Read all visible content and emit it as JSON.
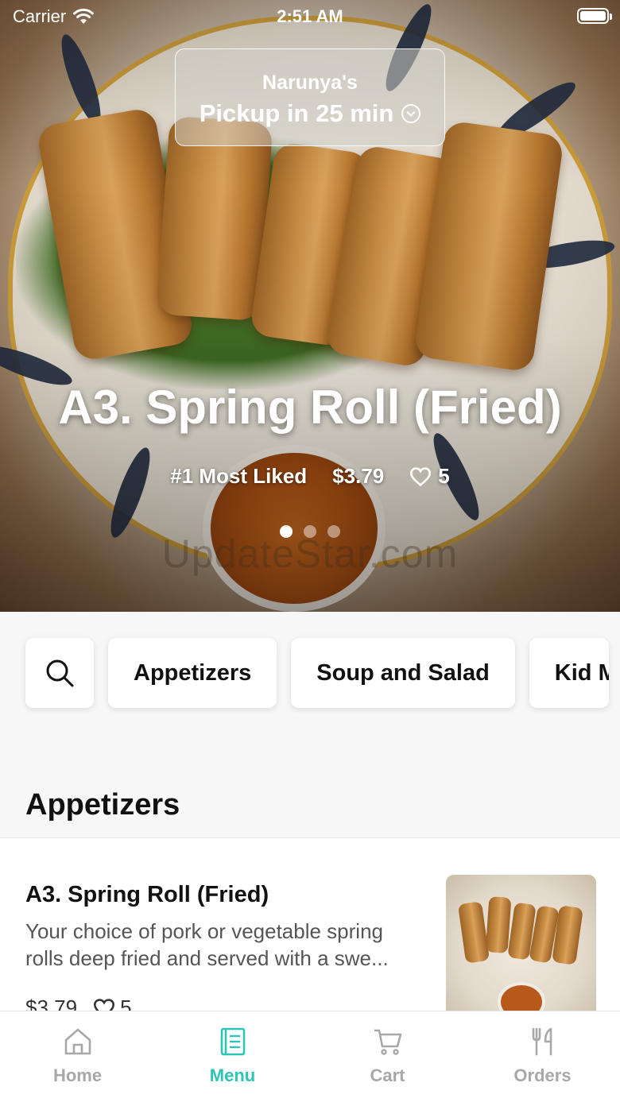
{
  "status_bar": {
    "carrier": "Carrier",
    "time": "2:51 AM"
  },
  "pickup": {
    "restaurant": "Narunya's",
    "eta": "Pickup in 25 min"
  },
  "hero": {
    "title": "A3. Spring Roll (Fried)",
    "badge": "#1 Most Liked",
    "price": "$3.79",
    "likes": "5",
    "carousel": {
      "count": 3,
      "active": 1
    },
    "watermark": "UpdateStar.com"
  },
  "categories": [
    {
      "icon": "search-icon"
    },
    {
      "label": "Appetizers"
    },
    {
      "label": "Soup and Salad"
    },
    {
      "label": "Kid M"
    }
  ],
  "section": {
    "title": "Appetizers"
  },
  "items": [
    {
      "name": "A3. Spring Roll (Fried)",
      "description": "Your choice of pork or vegetable spring rolls deep fried and served with a swe...",
      "price": "$3.79",
      "likes": "5"
    }
  ],
  "tabbar": {
    "tabs": [
      {
        "label": "Home",
        "icon": "home-icon"
      },
      {
        "label": "Menu",
        "icon": "menu-icon",
        "active": true
      },
      {
        "label": "Cart",
        "icon": "cart-icon"
      },
      {
        "label": "Orders",
        "icon": "utensils-icon"
      }
    ]
  },
  "colors": {
    "accent": "#2ec4b6",
    "tab_inactive": "#a8a8a8"
  }
}
